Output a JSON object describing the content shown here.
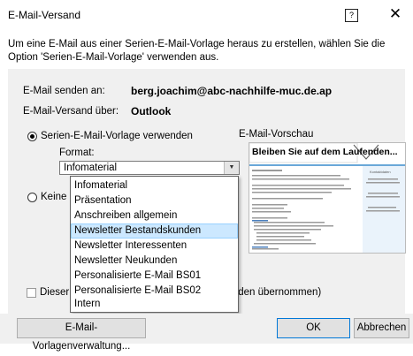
{
  "dialog": {
    "title": "E-Mail-Versand",
    "help_glyph": "?",
    "close_glyph": "✕"
  },
  "intro": "Um eine E-Mail aus einer Serien-E-Mail-Vorlage heraus zu erstellen, wählen Sie die Option 'Serien-E-Mail-Vorlage' verwenden aus.",
  "send_to": {
    "label": "E-Mail senden an:",
    "value": "berg.joachim@abc-nachhilfe-muc.de.ap"
  },
  "send_via": {
    "label": "E-Mail-Versand über:",
    "value": "Outlook"
  },
  "template_option": {
    "label": "Serien-E-Mail-Vorlage verwenden",
    "selected": true
  },
  "format": {
    "label": "Format:",
    "value": "Infomaterial",
    "arrow_glyph": "▼"
  },
  "format_options": [
    "Infomaterial",
    "Präsentation",
    "Anschreiben allgemein",
    "Newsletter Bestandskunden",
    "Newsletter Interessenten",
    "Newsletter Neukunden",
    "Personalisierte E-Mail BS01",
    "Personalisierte E-Mail BS02",
    "Intern"
  ],
  "format_highlighted": "Newsletter Bestandskunden",
  "none_option": {
    "label_visible": "Keine",
    "selected": false
  },
  "preview": {
    "label": "E-Mail-Vorschau",
    "headline": "Bleiben Sie auf dem Laufenden...",
    "side_heading": "Kontaktdaten"
  },
  "checkbox_row": {
    "label_left": "Dieser",
    "label_right": "erden übernommen)",
    "checked": false
  },
  "buttons": {
    "manage": "E-Mail-Vorlagenverwaltung...",
    "ok": "OK",
    "cancel": "Abbrechen"
  },
  "colors": {
    "selection": "#cce8ff",
    "panel": "#f0f0f0",
    "accent": "#0078d7"
  }
}
